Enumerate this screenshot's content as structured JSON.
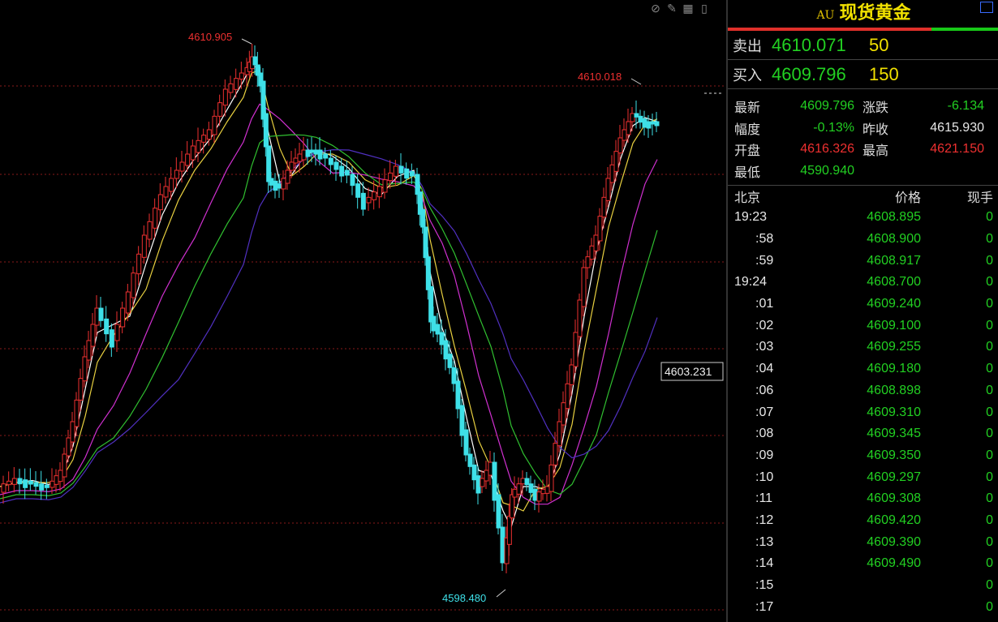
{
  "chart": {
    "high_label": "4610.905",
    "high_label2": "4610.018",
    "low_label": "4598.480",
    "cursor_price": "4603.231"
  },
  "panel": {
    "code": "AU",
    "name": "现货黄金",
    "sell_label": "卖出",
    "sell_price": "4610.071",
    "sell_vol": "50",
    "buy_label": "买入",
    "buy_price": "4609.796",
    "buy_vol": "150",
    "stats": {
      "latest_label": "最新",
      "latest": "4609.796",
      "change_label": "涨跌",
      "change": "-6.134",
      "range_label": "幅度",
      "range": "-0.13%",
      "prev_label": "昨收",
      "prev": "4615.930",
      "open_label": "开盘",
      "open": "4616.326",
      "high_label": "最高",
      "high": "4621.150",
      "low_label": "最低",
      "low": "4590.940"
    },
    "ticks_header": {
      "time": "北京",
      "price": "价格",
      "qty": "现手"
    },
    "ticks": [
      {
        "time": "19:23",
        "price": "4608.895",
        "qty": "0"
      },
      {
        "time": ":58",
        "price": "4608.900",
        "qty": "0"
      },
      {
        "time": ":59",
        "price": "4608.917",
        "qty": "0"
      },
      {
        "time": "19:24",
        "price": "4608.700",
        "qty": "0"
      },
      {
        "time": ":01",
        "price": "4609.240",
        "qty": "0"
      },
      {
        "time": ":02",
        "price": "4609.100",
        "qty": "0"
      },
      {
        "time": ":03",
        "price": "4609.255",
        "qty": "0"
      },
      {
        "time": ":04",
        "price": "4609.180",
        "qty": "0"
      },
      {
        "time": ":06",
        "price": "4608.898",
        "qty": "0"
      },
      {
        "time": ":07",
        "price": "4609.310",
        "qty": "0"
      },
      {
        "time": ":08",
        "price": "4609.345",
        "qty": "0"
      },
      {
        "time": ":09",
        "price": "4609.350",
        "qty": "0"
      },
      {
        "time": ":10",
        "price": "4609.297",
        "qty": "0"
      },
      {
        "time": ":11",
        "price": "4609.308",
        "qty": "0"
      },
      {
        "time": ":12",
        "price": "4609.420",
        "qty": "0"
      },
      {
        "time": ":13",
        "price": "4609.390",
        "qty": "0"
      },
      {
        "time": ":14",
        "price": "4609.490",
        "qty": "0"
      },
      {
        "time": ":15",
        "price": "",
        "qty": "0"
      },
      {
        "time": ":17",
        "price": "",
        "qty": "0"
      }
    ]
  }
}
